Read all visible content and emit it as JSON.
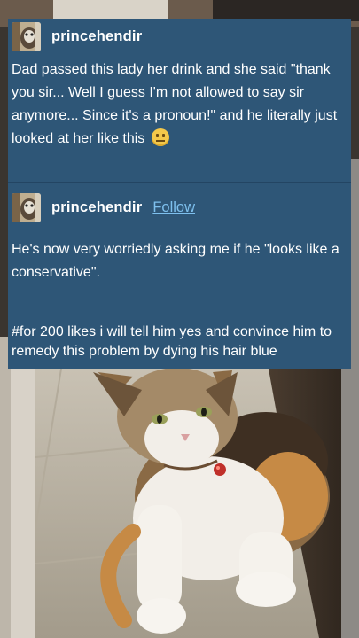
{
  "post1": {
    "username": "princehendir",
    "text": "Dad passed this lady her drink and she said \"thank you sir... Well I guess I'm not allowed to say sir anymore... Since it's a pronoun!\" and he literally just looked at her like this",
    "emoji": "neutral-face-emoji"
  },
  "post2": {
    "username": "princehendir",
    "follow_label": "Follow",
    "text": "He's now very worriedly asking me if he \"looks like a conservative\".",
    "tags": "#for 200 likes i will tell him yes and convince him to remedy this problem by dying his hair blue"
  },
  "colors": {
    "card_bg": "#2e5677",
    "follow_link": "#7ec0ee",
    "text": "#ffffff"
  }
}
